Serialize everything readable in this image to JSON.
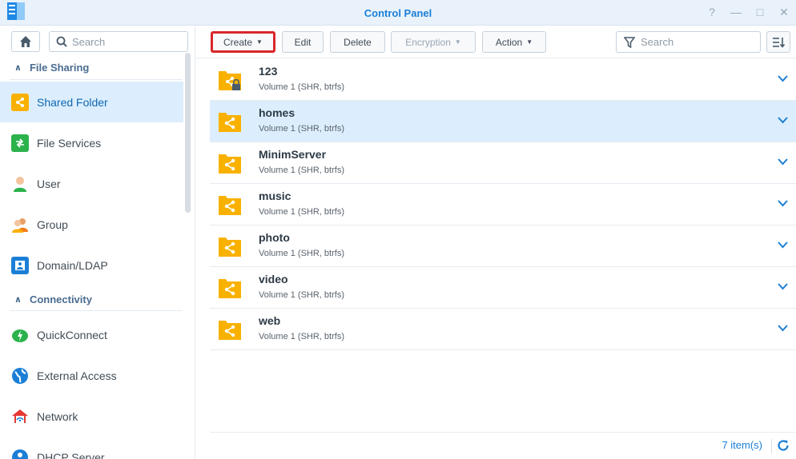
{
  "window": {
    "title": "Control Panel",
    "controls": [
      "?",
      "—",
      "□",
      "✕"
    ]
  },
  "sidebar": {
    "search_placeholder": "Search",
    "sections": {
      "file_sharing": "File Sharing",
      "connectivity": "Connectivity"
    },
    "items": [
      {
        "label": "Shared Folder",
        "icon": "shared-folder-icon"
      },
      {
        "label": "File Services",
        "icon": "file-services-icon"
      },
      {
        "label": "User",
        "icon": "user-icon"
      },
      {
        "label": "Group",
        "icon": "group-icon"
      },
      {
        "label": "Domain/LDAP",
        "icon": "domain-ldap-icon"
      },
      {
        "label": "QuickConnect",
        "icon": "quickconnect-icon"
      },
      {
        "label": "External Access",
        "icon": "external-access-icon"
      },
      {
        "label": "Network",
        "icon": "network-icon"
      },
      {
        "label": "DHCP Server",
        "icon": "dhcp-server-icon"
      }
    ]
  },
  "toolbar": {
    "create": "Create",
    "edit": "Edit",
    "delete": "Delete",
    "encryption": "Encryption",
    "action": "Action",
    "search_placeholder": "Search"
  },
  "folders": [
    {
      "name": "123",
      "location": "Volume 1 (SHR, btrfs)"
    },
    {
      "name": "homes",
      "location": "Volume 1 (SHR, btrfs)"
    },
    {
      "name": "MinimServer",
      "location": "Volume 1 (SHR, btrfs)"
    },
    {
      "name": "music",
      "location": "Volume 1 (SHR, btrfs)"
    },
    {
      "name": "photo",
      "location": "Volume 1 (SHR, btrfs)"
    },
    {
      "name": "video",
      "location": "Volume 1 (SHR, btrfs)"
    },
    {
      "name": "web",
      "location": "Volume 1 (SHR, btrfs)"
    }
  ],
  "footer": {
    "count": "7 item(s)"
  },
  "colors": {
    "accent": "#1b7fd6",
    "selected_row": "#dceefd",
    "folder": "#f9b100",
    "highlight_border": "#d9262a"
  }
}
